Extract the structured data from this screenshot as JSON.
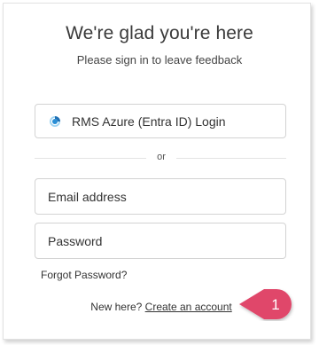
{
  "heading": "We're glad you're here",
  "subheading": "Please sign in to leave feedback",
  "sso": {
    "label": "RMS Azure (Entra ID) Login",
    "icon": "azure-entra-icon"
  },
  "divider": {
    "text": "or"
  },
  "email": {
    "placeholder": "Email address",
    "value": ""
  },
  "password": {
    "placeholder": "Password",
    "value": ""
  },
  "forgot_password": "Forgot Password?",
  "signup": {
    "prompt": "New here?",
    "link": "Create an account"
  },
  "callout": {
    "number": "1",
    "color": "#e0466b"
  }
}
